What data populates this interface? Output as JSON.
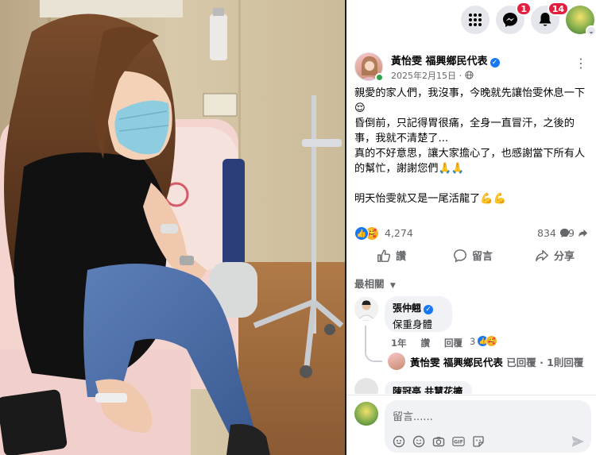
{
  "topbar": {
    "messenger_badge": "1",
    "notifications_badge": "14"
  },
  "post": {
    "author": "黃怡雯 福興鄉民代表",
    "date": "2025年2月15日",
    "lines": [
      "親愛的家人們，我沒事，今晚就先讓怡雯休息一下😌",
      "昏倒前，只記得胃很痛，全身一直冒汗，之後的事，我就不清楚了...",
      "真的不好意思，讓大家擔心了，也感謝當下所有人的幫忙，謝謝您們🙏🙏",
      "",
      "明天怡雯就又是一尾活龍了💪💪"
    ],
    "reaction_count": "4,274",
    "comment_count": "834",
    "share_count": "19"
  },
  "actions": {
    "like": "讚",
    "comment": "留言",
    "share": "分享"
  },
  "comments": {
    "sort_label": "最相關",
    "first": {
      "name": "張仲翹",
      "text": "保重身體",
      "time": "1年",
      "like": "讚",
      "reply": "回覆",
      "reaction_count": "3"
    },
    "reply_summary": {
      "name": "黃怡雯 福興鄉民代表",
      "suffix": "已回覆 · 1則回覆"
    },
    "next_name": "陳冠亭 共慧花擴"
  },
  "composer": {
    "placeholder": "留言......"
  },
  "colors": {
    "facebook_blue": "#1877f2",
    "badge_red": "#e41e3f",
    "secondary_text": "#65676b",
    "bubble_bg": "#f0f2f5"
  },
  "icons": [
    "menu-grid-icon",
    "messenger-icon",
    "bell-icon",
    "profile-avatar",
    "globe-icon",
    "like-icon",
    "comment-icon",
    "share-icon",
    "emoji-icon",
    "camera-icon",
    "gif-icon",
    "sticker-icon",
    "send-icon"
  ]
}
